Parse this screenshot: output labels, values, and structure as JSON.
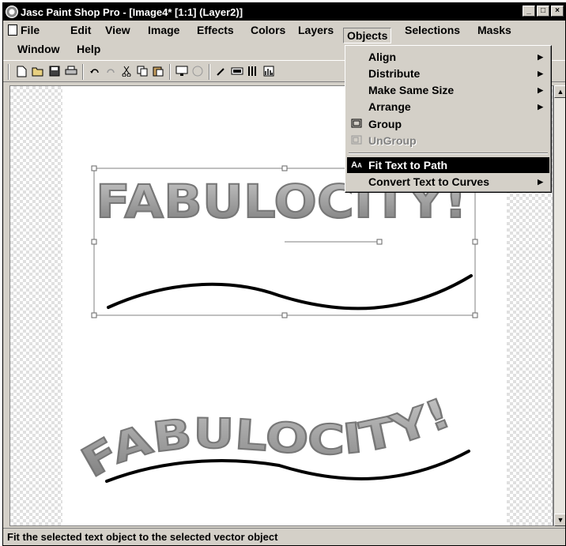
{
  "window": {
    "title": "Jasc Paint Shop Pro - [Image4* [1:1] (Layer2)]",
    "controls": [
      "_",
      "□",
      "×"
    ]
  },
  "menubar": {
    "row1": [
      {
        "label": "File",
        "underline": "F"
      },
      {
        "label": "Edit",
        "underline": "E"
      },
      {
        "label": "View",
        "underline": "V"
      },
      {
        "label": "Image",
        "underline": "I"
      },
      {
        "label": "Effects",
        "underline": "c"
      },
      {
        "label": "Colors",
        "underline": "C"
      },
      {
        "label": "Layers",
        "underline": "L"
      },
      {
        "label": "Objects",
        "underline": "O"
      },
      {
        "label": "Selections",
        "underline": "S"
      },
      {
        "label": "Masks",
        "underline": "M"
      }
    ],
    "row2": [
      {
        "label": "Window",
        "underline": "W"
      },
      {
        "label": "Help",
        "underline": "H"
      }
    ],
    "active": "Objects"
  },
  "objects_menu": {
    "items": [
      {
        "label": "Align",
        "submenu": true,
        "enabled": true
      },
      {
        "label": "Distribute",
        "submenu": true,
        "enabled": true
      },
      {
        "label": "Make Same Size",
        "submenu": true,
        "enabled": true
      },
      {
        "label": "Arrange",
        "submenu": true,
        "enabled": true
      },
      {
        "label": "Group",
        "submenu": false,
        "enabled": true,
        "icon": "group-icon"
      },
      {
        "label": "UnGroup",
        "submenu": false,
        "enabled": false,
        "icon": "ungroup-icon"
      },
      {
        "label": "Fit Text to Path",
        "submenu": false,
        "enabled": true,
        "selected": true,
        "icon": "fit-text-icon"
      },
      {
        "label": "Convert Text to Curves",
        "submenu": true,
        "enabled": true
      }
    ]
  },
  "canvas": {
    "text_art": "FABULOCITY!",
    "text_fill_top": "#c8c8c8",
    "text_fill_bottom": "#7a7a7a",
    "text_stroke": "#777777",
    "path_color": "#000000"
  },
  "statusbar": {
    "text": "Fit the selected text object to the selected vector object"
  }
}
